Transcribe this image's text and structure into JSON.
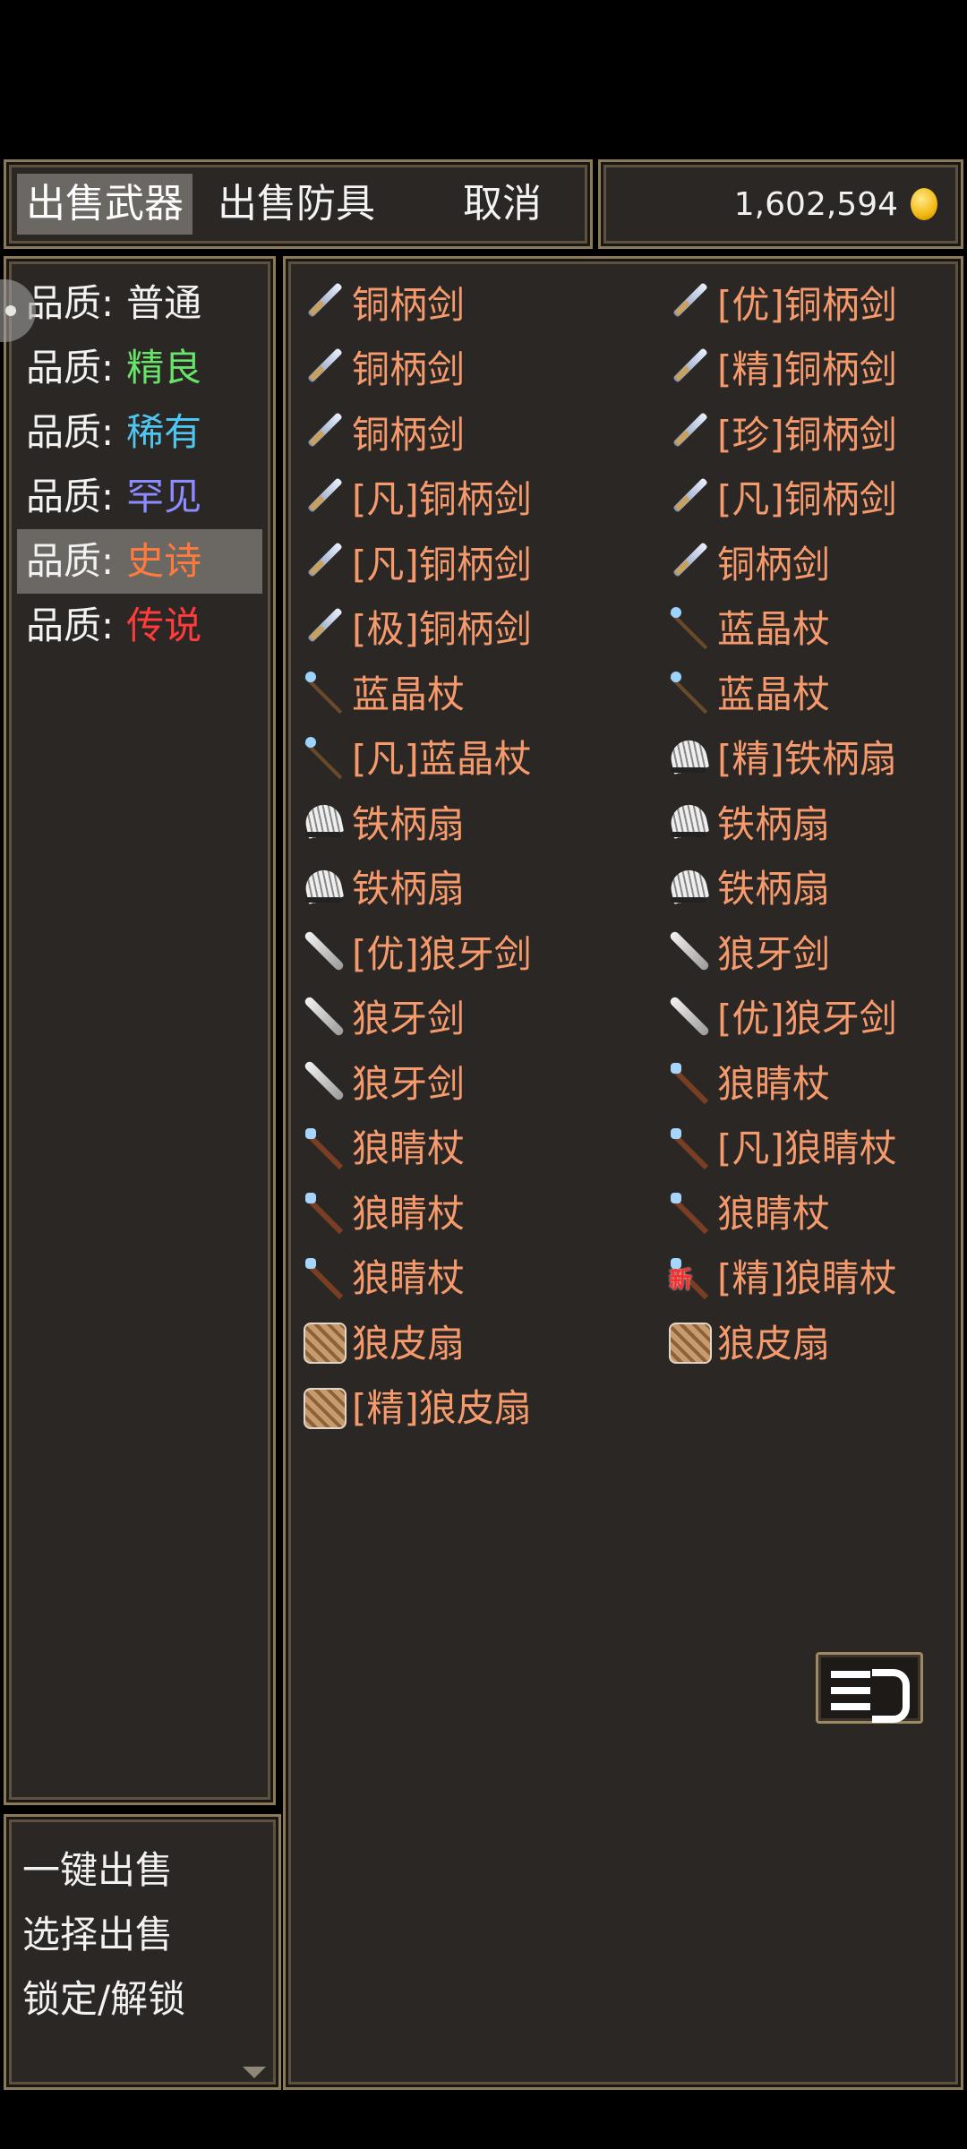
{
  "tabs": {
    "sell_weapons": "出售武器",
    "sell_armor": "出售防具",
    "cancel": "取消"
  },
  "currency": {
    "amount": "1,602,594",
    "icon": "gold-coin-icon"
  },
  "quality_filter": {
    "label": "品质:",
    "items": [
      {
        "value": "普通",
        "color": "#f2f2f2"
      },
      {
        "value": "精良",
        "color": "#67e56b"
      },
      {
        "value": "稀有",
        "color": "#4fc6ef"
      },
      {
        "value": "罕见",
        "color": "#8b8cff"
      },
      {
        "value": "史诗",
        "color": "#ff7a3d"
      },
      {
        "value": "传说",
        "color": "#ff3b3b"
      }
    ],
    "selected": "史诗"
  },
  "actions": {
    "quick_sell": "一键出售",
    "select_sell": "选择出售",
    "lock_unlock": "锁定/解锁"
  },
  "inventory": [
    {
      "label": "铜柄剑",
      "icon": "copper-sword-icon"
    },
    {
      "label": "[优]铜柄剑",
      "icon": "copper-sword-icon"
    },
    {
      "label": "铜柄剑",
      "icon": "copper-sword-icon"
    },
    {
      "label": "[精]铜柄剑",
      "icon": "copper-sword-icon"
    },
    {
      "label": "铜柄剑",
      "icon": "copper-sword-icon"
    },
    {
      "label": "[珍]铜柄剑",
      "icon": "copper-sword-icon"
    },
    {
      "label": "[凡]铜柄剑",
      "icon": "copper-sword-icon"
    },
    {
      "label": "[凡]铜柄剑",
      "icon": "copper-sword-icon"
    },
    {
      "label": "[凡]铜柄剑",
      "icon": "copper-sword-icon"
    },
    {
      "label": "铜柄剑",
      "icon": "copper-sword-icon"
    },
    {
      "label": "[极]铜柄剑",
      "icon": "copper-sword-icon"
    },
    {
      "label": "蓝晶杖",
      "icon": "blue-crystal-staff-icon"
    },
    {
      "label": "蓝晶杖",
      "icon": "blue-crystal-staff-icon"
    },
    {
      "label": "蓝晶杖",
      "icon": "blue-crystal-staff-icon"
    },
    {
      "label": "[凡]蓝晶杖",
      "icon": "blue-crystal-staff-icon"
    },
    {
      "label": "[精]铁柄扇",
      "icon": "iron-fan-icon"
    },
    {
      "label": "铁柄扇",
      "icon": "iron-fan-icon"
    },
    {
      "label": "铁柄扇",
      "icon": "iron-fan-icon"
    },
    {
      "label": "铁柄扇",
      "icon": "iron-fan-icon"
    },
    {
      "label": "铁柄扇",
      "icon": "iron-fan-icon"
    },
    {
      "label": "[优]狼牙剑",
      "icon": "wolf-fang-sword-icon"
    },
    {
      "label": "狼牙剑",
      "icon": "wolf-fang-sword-icon"
    },
    {
      "label": "狼牙剑",
      "icon": "wolf-fang-sword-icon"
    },
    {
      "label": "[优]狼牙剑",
      "icon": "wolf-fang-sword-icon"
    },
    {
      "label": "狼牙剑",
      "icon": "wolf-fang-sword-icon"
    },
    {
      "label": "狼睛杖",
      "icon": "wolf-eye-staff-icon"
    },
    {
      "label": "狼睛杖",
      "icon": "wolf-eye-staff-icon"
    },
    {
      "label": "[凡]狼睛杖",
      "icon": "wolf-eye-staff-icon"
    },
    {
      "label": "狼睛杖",
      "icon": "wolf-eye-staff-icon"
    },
    {
      "label": "狼睛杖",
      "icon": "wolf-eye-staff-icon"
    },
    {
      "label": "狼睛杖",
      "icon": "wolf-eye-staff-icon"
    },
    {
      "label": "[精]狼睛杖",
      "icon": "wolf-eye-staff-icon",
      "new_badge": "新"
    },
    {
      "label": "狼皮扇",
      "icon": "wolf-leather-fan-icon"
    },
    {
      "label": "狼皮扇",
      "icon": "wolf-leather-fan-icon"
    },
    {
      "label": "[精]狼皮扇",
      "icon": "wolf-leather-fan-icon"
    }
  ],
  "sort_button": {
    "icon": "sort-icon"
  }
}
